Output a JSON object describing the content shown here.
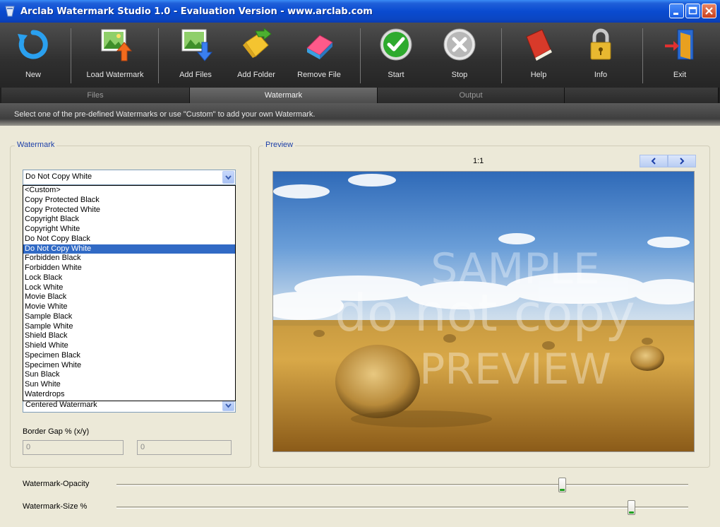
{
  "window": {
    "title": "Arclab Watermark Studio 1.0 - Evaluation Version - www.arclab.com"
  },
  "toolbar": {
    "new": "New",
    "load_watermark": "Load Watermark",
    "add_files": "Add Files",
    "add_folder": "Add Folder",
    "remove_file": "Remove File",
    "start": "Start",
    "stop": "Stop",
    "help": "Help",
    "info": "Info",
    "exit": "Exit"
  },
  "tabs": [
    {
      "label": "Files",
      "active": false
    },
    {
      "label": "Watermark",
      "active": true
    },
    {
      "label": "Output",
      "active": false
    }
  ],
  "info_text": "Select one of the pre-defined Watermarks or use \"Custom\" to add your own Watermark.",
  "watermark_panel": {
    "label": "Watermark",
    "selected": "Do Not Copy White",
    "options": [
      "<Custom>",
      "Copy Protected Black",
      "Copy Protected White",
      "Copyright Black",
      "Copyright White",
      "Do Not Copy Black",
      "Do Not Copy White",
      "Forbidden Black",
      "Forbidden White",
      "Lock Black",
      "Lock White",
      "Movie Black",
      "Movie White",
      "Sample Black",
      "Sample White",
      "Shield Black",
      "Shield White",
      "Specimen Black",
      "Specimen White",
      "Sun Black",
      "Sun White",
      "Waterdrops"
    ],
    "position_selected": "Centered Watermark",
    "border_gap_label": "Border Gap % (x/y)",
    "border_gap_x": "0",
    "border_gap_y": "0"
  },
  "preview_panel": {
    "label": "Preview",
    "zoom": "1:1",
    "prev_symbol": "‹",
    "next_symbol": "›",
    "watermark_lines": [
      "SAMPLE",
      "do not copy",
      "PREVIEW"
    ]
  },
  "sliders": {
    "opacity_label": "Watermark-Opacity",
    "opacity_value": 0.78,
    "size_label": "Watermark-Size %",
    "size_value": 0.9
  },
  "colors": {
    "title_bar": "#0a4bd0",
    "toolbar_bg": "#2f2f2f",
    "selection": "#316ac5",
    "group_label": "#1c3fa8"
  }
}
